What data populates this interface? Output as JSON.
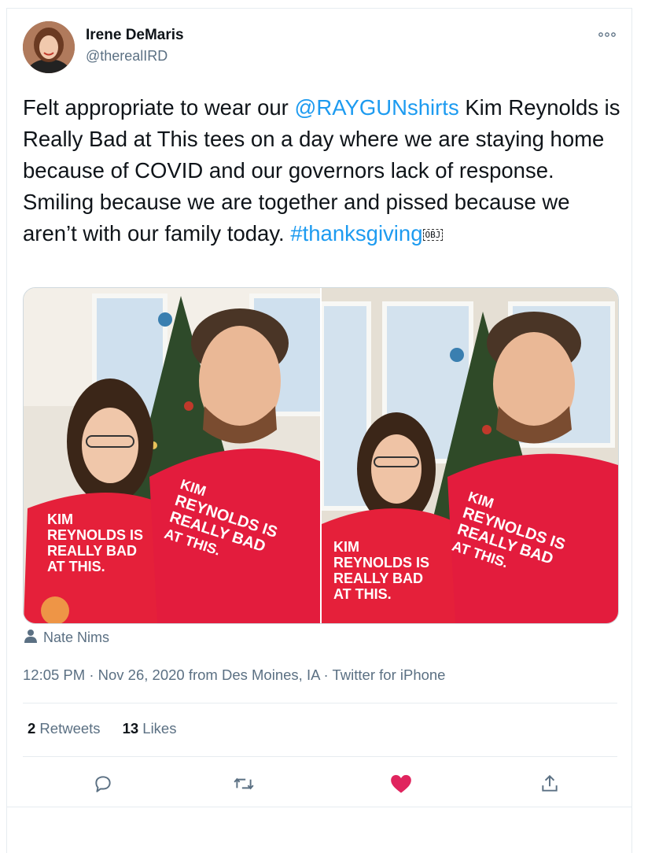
{
  "author": {
    "name": "Irene DeMaris",
    "handle": "@therealIRD"
  },
  "tweet": {
    "text_1": "Felt appropriate to wear our ",
    "mention": "@RAYGUNshirts",
    "text_2": " Kim Reynolds is Really Bad at This tees on a day where we are staying home because of COVID and our governors lack of response. Smiling because we are together and pissed because we aren’t with our family today. ",
    "hashtag": "#thanksgiving",
    "obj_glyph": "OBJ"
  },
  "media": {
    "shirt_lines_left": [
      "KIM",
      "REYNOLDS IS",
      "REALLY BAD",
      "AT THIS."
    ],
    "shirt_lines_right": [
      "KIM",
      "REYNOLDS IS",
      "REALLY BAD",
      "AT THIS."
    ]
  },
  "tagged_user": "Nate Nims",
  "meta": {
    "time": "12:05 PM",
    "sep1": " · ",
    "date": "Nov 26, 2020",
    "location": " from Des Moines, IA",
    "sep2": " · ",
    "source": "Twitter for iPhone"
  },
  "stats": {
    "retweets_count": "2",
    "retweets_label": " Retweets",
    "likes_count": "13",
    "likes_label": " Likes"
  },
  "icons": {
    "reply": "reply-icon",
    "retweet": "retweet-icon",
    "like": "heart-icon",
    "share": "share-icon",
    "more": "more-icon",
    "person": "person-icon"
  },
  "colors": {
    "accent": "#1d9bf0",
    "like": "#e0245e",
    "secondary_text": "#5b7083"
  }
}
